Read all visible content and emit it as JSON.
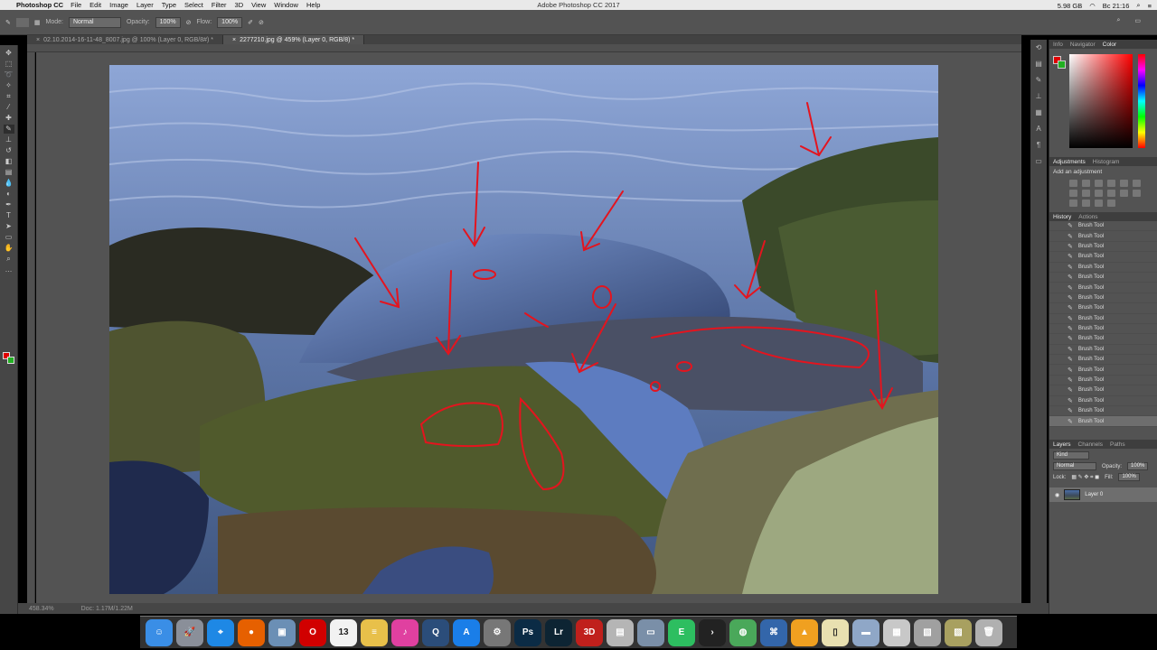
{
  "menubar": {
    "app_name": "Photoshop CC",
    "items": [
      "File",
      "Edit",
      "Image",
      "Layer",
      "Type",
      "Select",
      "Filter",
      "3D",
      "View",
      "Window",
      "Help"
    ],
    "window_title": "Adobe Photoshop CC 2017",
    "memory": "5.98 GB",
    "clock": "Вс 21:16"
  },
  "options": {
    "mode_label": "Mode:",
    "mode_value": "Normal",
    "opacity_label": "Opacity:",
    "opacity_value": "100%",
    "flow_label": "Flow:",
    "flow_value": "100%"
  },
  "tabs": [
    {
      "label": "02.10.2014-16-11-48_8007.jpg @ 100% (Layer 0, RGB/8#) *"
    },
    {
      "label": "2277210.jpg @ 459% (Layer 0, RGB/8) *"
    }
  ],
  "status": {
    "zoom": "458.34%",
    "doc": "Doc: 1.17M/1.22M"
  },
  "color_panel": {
    "tabs": [
      "Info",
      "Navigator",
      "Color"
    ],
    "fg_color": "#e00000",
    "bg_color": "#22b022"
  },
  "adjustments": {
    "tabs": [
      "Adjustments",
      "Histogram"
    ],
    "hint": "Add an adjustment"
  },
  "history": {
    "tabs": [
      "History",
      "Actions"
    ],
    "items": [
      "Brush Tool",
      "Brush Tool",
      "Brush Tool",
      "Brush Tool",
      "Brush Tool",
      "Brush Tool",
      "Brush Tool",
      "Brush Tool",
      "Brush Tool",
      "Brush Tool",
      "Brush Tool",
      "Brush Tool",
      "Brush Tool",
      "Brush Tool",
      "Brush Tool",
      "Brush Tool",
      "Brush Tool",
      "Brush Tool",
      "Brush Tool",
      "Brush Tool"
    ]
  },
  "layers": {
    "tabs": [
      "Layers",
      "Channels",
      "Paths"
    ],
    "kind": "Kind",
    "blend": "Normal",
    "opacity_label": "Opacity:",
    "opacity_value": "100%",
    "lock_label": "Lock:",
    "fill_label": "Fill:",
    "fill_value": "100%",
    "layer_name": "Layer 0"
  },
  "dock": {
    "apps": [
      {
        "name": "Finder",
        "color": "#3a8ee6",
        "glyph": "☺"
      },
      {
        "name": "Launchpad",
        "color": "#8a8f99",
        "glyph": "🚀"
      },
      {
        "name": "Safari",
        "color": "#1e88e5",
        "glyph": "⌖"
      },
      {
        "name": "Firefox",
        "color": "#e66000",
        "glyph": "●"
      },
      {
        "name": "Preview",
        "color": "#6b8fb5",
        "glyph": "▣"
      },
      {
        "name": "Opera",
        "color": "#d10000",
        "glyph": "O"
      },
      {
        "name": "Calendar",
        "color": "#f2f2f2",
        "glyph": "13"
      },
      {
        "name": "Notes",
        "color": "#e8c04a",
        "glyph": "≡"
      },
      {
        "name": "iTunes",
        "color": "#e040a0",
        "glyph": "♪"
      },
      {
        "name": "QuickTime",
        "color": "#2b4d7a",
        "glyph": "Q"
      },
      {
        "name": "App Store",
        "color": "#1a7ee8",
        "glyph": "A"
      },
      {
        "name": "System Preferences",
        "color": "#777",
        "glyph": "⚙"
      },
      {
        "name": "Photoshop",
        "color": "#0b2b45",
        "glyph": "Ps"
      },
      {
        "name": "Lightroom",
        "color": "#0d2433",
        "glyph": "Lr"
      },
      {
        "name": "3DNews",
        "color": "#c0201c",
        "glyph": "3D"
      },
      {
        "name": "Photos",
        "color": "#b5b5b5",
        "glyph": "▤"
      },
      {
        "name": "Image Capture",
        "color": "#7a8fa8",
        "glyph": "▭"
      },
      {
        "name": "Evernote",
        "color": "#2dbe60",
        "glyph": "E"
      },
      {
        "name": "Forward",
        "color": "#222",
        "glyph": "›"
      },
      {
        "name": "Globe",
        "color": "#4aa85a",
        "glyph": "◍"
      },
      {
        "name": "Remote Desktop",
        "color": "#3366aa",
        "glyph": "⌘"
      },
      {
        "name": "VLC",
        "color": "#f0a020",
        "glyph": "▲"
      },
      {
        "name": "Documents",
        "color": "#e8e0b0",
        "glyph": "▯"
      },
      {
        "name": "Downloads",
        "color": "#8fa7c7",
        "glyph": "▬"
      },
      {
        "name": "Folder",
        "color": "#c8c8c8",
        "glyph": "▦"
      },
      {
        "name": "Screenshots",
        "color": "#a0a0a0",
        "glyph": "▧"
      },
      {
        "name": "Pictures",
        "color": "#a8a060",
        "glyph": "▨"
      },
      {
        "name": "Trash",
        "color": "#b0b0b0",
        "glyph": "🗑"
      }
    ]
  }
}
